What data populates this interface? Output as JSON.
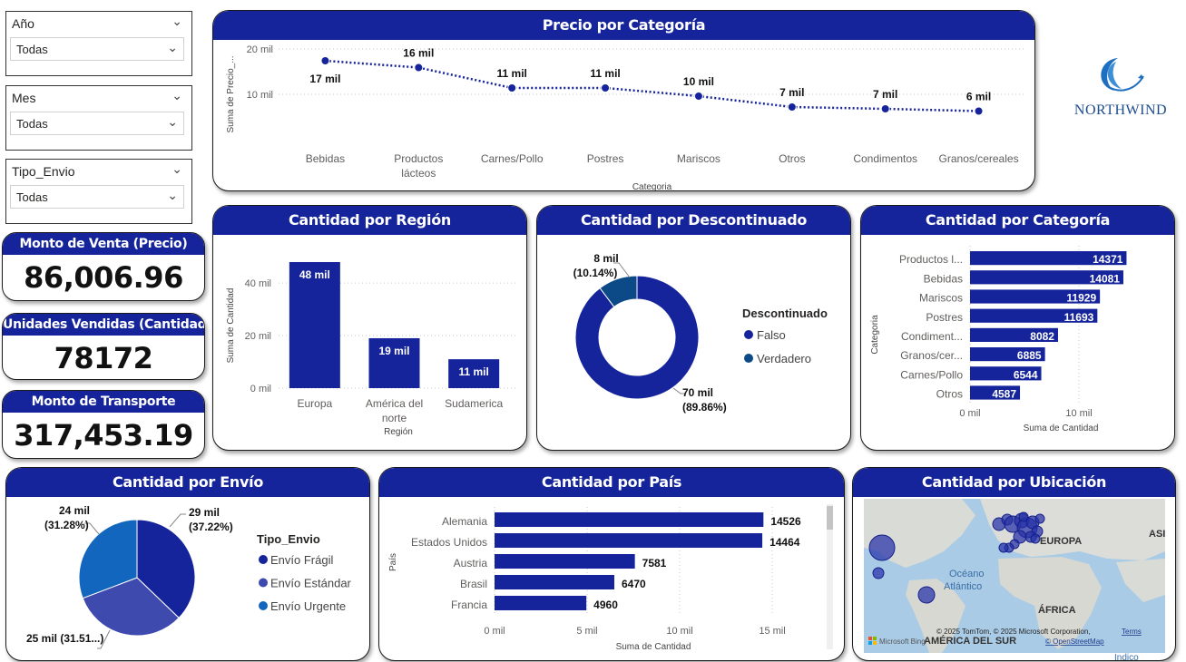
{
  "filters": [
    {
      "label": "Año",
      "value": "Todas"
    },
    {
      "label": "Mes",
      "value": "Todas"
    },
    {
      "label": "Tipo_Envio",
      "value": "Todas"
    }
  ],
  "kpis": [
    {
      "label": "Monto de Venta (Precio)",
      "value": "86,006.96"
    },
    {
      "label": "Unidades Vendidas (Cantidad",
      "value": "78172"
    },
    {
      "label": "Monto de Transporte",
      "value": "317,453.19"
    }
  ],
  "logo": {
    "text": "NORTHWIND"
  },
  "colors": {
    "primary": "#16249b",
    "secondary": "#0b4a86",
    "estandar": "#3f4aaf",
    "urgente": "#1366bd"
  },
  "chart_data": [
    {
      "id": "precio",
      "title": "Precio por Categoría",
      "type": "line",
      "categories": [
        "Bebidas",
        "Productos lácteos",
        "Carnes/Pollo",
        "Postres",
        "Mariscos",
        "Otros",
        "Condimentos",
        "Granos/cereales"
      ],
      "values": [
        17.4,
        15.9,
        11.4,
        11.4,
        9.6,
        7.2,
        6.8,
        6.3
      ],
      "data_labels": [
        "17 mil",
        "16 mil",
        "11 mil",
        "11 mil",
        "10 mil",
        "7 mil",
        "7 mil",
        "6 mil"
      ],
      "xlabel": "Categoria",
      "ylabel": "Suma de Precio_...",
      "ylim": [
        0,
        20
      ],
      "yticks": [
        10,
        20
      ],
      "ytick_labels": [
        "10 mil",
        "20 mil"
      ],
      "grid": true
    },
    {
      "id": "region",
      "title": "Cantidad por Región",
      "type": "bar",
      "categories": [
        "Europa",
        "América del norte",
        "Sudamerica"
      ],
      "values": [
        48,
        19,
        11
      ],
      "data_labels": [
        "48 mil",
        "19 mil",
        "11 mil"
      ],
      "xlabel": "Región",
      "ylabel": "Suma de Cantidad",
      "ylim": [
        0,
        48
      ],
      "yticks": [
        0,
        20,
        40
      ],
      "ytick_labels": [
        "0 mil",
        "20 mil",
        "40 mil"
      ],
      "grid": true
    },
    {
      "id": "descontinuado",
      "title": "Cantidad por Descontinuado",
      "type": "pie",
      "donut": true,
      "legend_title": "Descontinuado",
      "labels": [
        "Falso",
        "Verdadero"
      ],
      "values": [
        70,
        8
      ],
      "percentages": [
        89.86,
        10.14
      ],
      "data_labels": [
        "70 mil",
        "8 mil"
      ],
      "pct_labels": [
        "(89.86%)",
        "(10.14%)"
      ],
      "legend": "right"
    },
    {
      "id": "categoria",
      "title": "Cantidad por Categoría",
      "type": "bar",
      "orientation": "horizontal",
      "categories": [
        "Productos l...",
        "Bebidas",
        "Mariscos",
        "Postres",
        "Condiment...",
        "Granos/cer...",
        "Carnes/Pollo",
        "Otros"
      ],
      "values": [
        14371,
        14081,
        11929,
        11693,
        8082,
        6885,
        6544,
        4587
      ],
      "xlabel": "Suma de Cantidad",
      "ylabel": "Categoria",
      "xlim": [
        0,
        15000
      ],
      "xticks": [
        0,
        10000
      ],
      "xtick_labels": [
        "0 mil",
        "10 mil"
      ]
    },
    {
      "id": "envio",
      "title": "Cantidad por Envío",
      "type": "pie",
      "legend_title": "Tipo_Envio",
      "labels": [
        "Envío Frágil",
        "Envío Estándar",
        "Envío Urgente"
      ],
      "values": [
        29,
        25,
        24
      ],
      "percentages": [
        37.22,
        31.51,
        31.28
      ],
      "data_labels": [
        "29 mil",
        "25 mil (31.51...)",
        "24 mil"
      ],
      "pct_labels": [
        "(37.22%)",
        "",
        "(31.28%)"
      ],
      "legend": "right"
    },
    {
      "id": "pais",
      "title": "Cantidad por País",
      "type": "bar",
      "orientation": "horizontal",
      "categories": [
        "Alemania",
        "Estados Unidos",
        "Austria",
        "Brasil",
        "Francia"
      ],
      "values": [
        14526,
        14464,
        7581,
        6470,
        4960
      ],
      "xlabel": "Suma de Cantidad",
      "ylabel": "País",
      "xlim": [
        0,
        15000
      ],
      "xticks": [
        0,
        5000,
        10000,
        15000
      ],
      "xtick_labels": [
        "0 mil",
        "5 mil",
        "10 mil",
        "15 mil"
      ]
    }
  ],
  "map": {
    "title": "Cantidad por Ubicación",
    "labels": {
      "europa": "EUROPA",
      "asia": "ASI",
      "oceano1": "Océano",
      "oceano2": "Atlántico",
      "africa": "ÁFRICA",
      "sudamerica": "AMÉRICA DEL SUR",
      "indico": "Indico"
    },
    "attribution": "© 2025 TomTom, © 2025 Microsoft Corporation,",
    "terms": "Terms",
    "osm": "© OpenStreetMap",
    "bing": "Microsoft Bing"
  }
}
